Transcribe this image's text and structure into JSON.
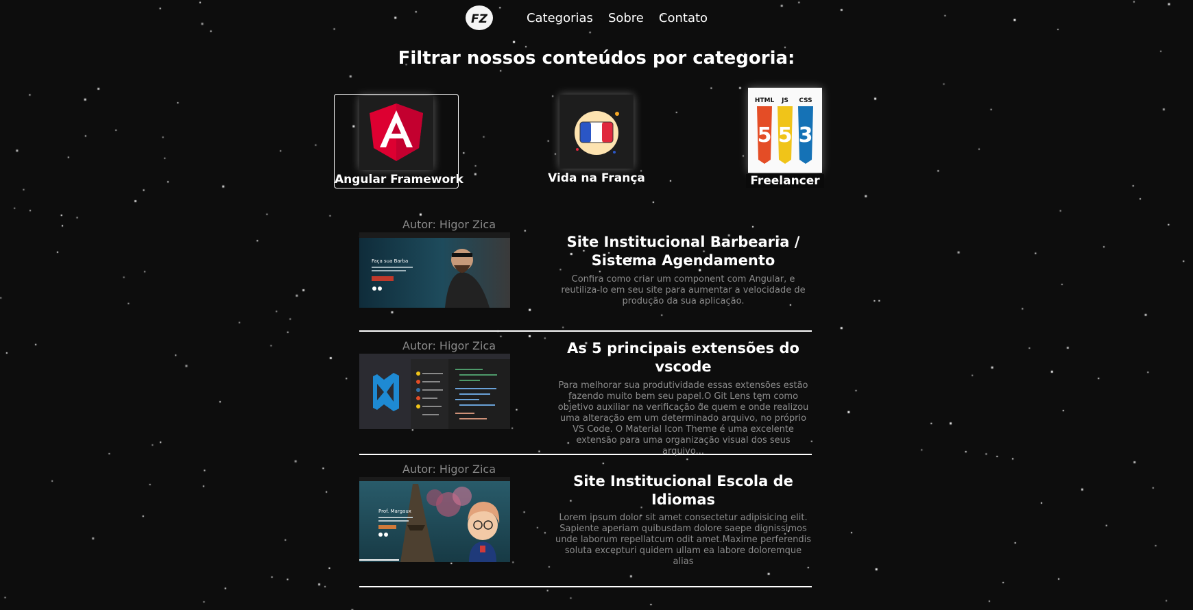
{
  "nav": {
    "logo_text": "FZ",
    "links": [
      "Categorias",
      "Sobre",
      "Contato"
    ]
  },
  "filter_title": "Filtrar nossos conteúdos por categoria:",
  "categories": [
    {
      "label": "Angular Framework",
      "icon": "angular-logo-icon"
    },
    {
      "label": "Vida na França",
      "icon": "french-flag-icon"
    },
    {
      "label": "Freelancer",
      "icon": "html-js-css-icon",
      "badges": [
        "HTML",
        "JS",
        "CSS"
      ]
    }
  ],
  "posts": [
    {
      "author": "Autor: Higor Zica",
      "title": "Site Institucional Barbearia / Sistema Agendamento",
      "description": "Confira como criar um component com Angular, e reutiliza-lo em seu site para aumentar a velocidade de produção da sua aplicação.",
      "image_caption": "Faça sua Barba"
    },
    {
      "author": "Autor: Higor Zica",
      "title": "As 5 principais extensões do vscode",
      "description": "Para melhorar sua produtividade essas extensões estão fazendo muito bem seu papel.O Git Lens tem como objetivo auxiliar na verificação de quem e onde realizou uma alteração em um determinado arquivo, no próprio VS Code. O Material Icon Theme é uma excelente extensão para uma organização visual dos seus arquivo..."
    },
    {
      "author": "Autor: Higor Zica",
      "title": "Site Institucional Escola de Idiomas",
      "description": "Lorem ipsum dolor sit amet consectetur adipisicing elit. Sapiente aperiam quibusdam dolore saepe dignissimos unde laborum repellatcum odit amet.Maxime perferendis soluta excepturi quidem ullam ea labore doloremque alias",
      "image_caption": "Prof. Margaux"
    }
  ],
  "colors": {
    "background": "#0d0d0d",
    "angular_red": "#dd0031",
    "text_muted": "#8c8c8c"
  }
}
